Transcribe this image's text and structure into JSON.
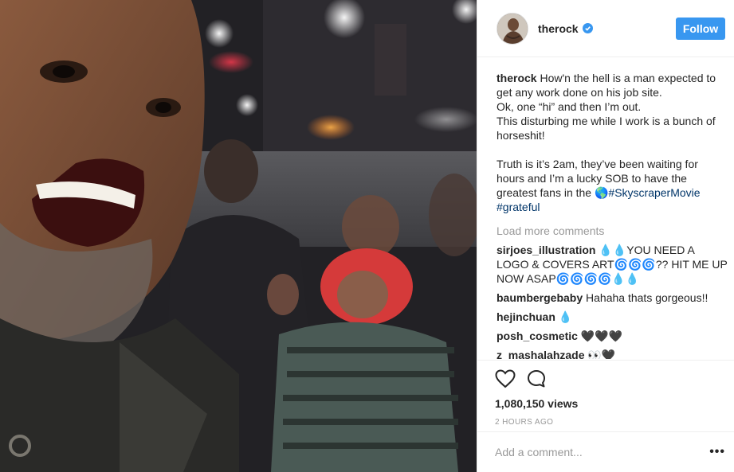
{
  "post": {
    "username": "therock",
    "follow_label": "Follow",
    "caption": {
      "username": "therock",
      "line1": "How'n the hell is a man expected to get any work done on his job site.",
      "line2": "Ok, one “hi” and then I’m out.",
      "line3": "This disturbing me while I work is a bunch of horseshit!",
      "line4": "Truth is it’s 2am, they’ve been waiting for hours and I’m a lucky SOB to have the greatest fans in the 🌎",
      "hashtag1": "#SkyscraperMovie",
      "hashtag2": "#grateful"
    },
    "load_more": "Load more comments",
    "comments": [
      {
        "user": "sirjoes_illustration",
        "text": "💧💧YOU NEED A LOGO & COVERS ART🌀🌀🌀?? HIT ME UP NOW ASAP🌀🌀🌀🌀💧💧"
      },
      {
        "user": "baumbergebaby",
        "text": "Hahaha thats gorgeous!!"
      },
      {
        "user": "hejinchuan",
        "text": "💧"
      },
      {
        "user": "posh_cosmetic",
        "text": "🖤🖤🖤"
      },
      {
        "user": "z_mashalahzade",
        "text": "👀🖤"
      }
    ],
    "views": "1,080,150 views",
    "time_ago": "2 HOURS AGO",
    "add_comment_placeholder": "Add a comment...",
    "more_options": "•••"
  },
  "icons": {
    "like": "heart-icon",
    "comment": "comment-bubble-icon",
    "verified": "verified-badge-icon",
    "more": "more-options-icon"
  },
  "colors": {
    "accent": "#3897f0",
    "hashtag": "#003569",
    "muted": "#999999",
    "text": "#262626",
    "border": "#efefef"
  }
}
